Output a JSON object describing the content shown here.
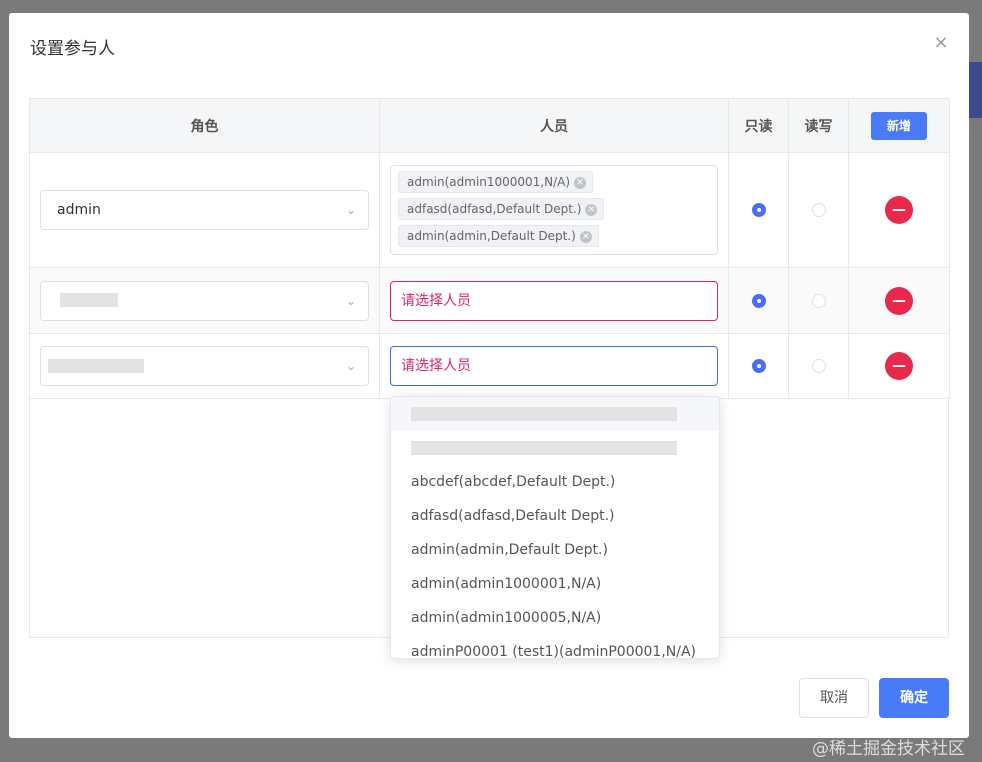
{
  "dialog": {
    "title": "设置参与人",
    "close_icon": "×"
  },
  "table": {
    "headers": {
      "role": "角色",
      "person": "人员",
      "readonly": "只读",
      "readwrite": "读写",
      "add": "新增"
    },
    "rows": [
      {
        "role": "admin",
        "persons": [
          "admin(admin1000001,N/A)",
          "adfasd(adfasd,Default Dept.)",
          "admin(admin,Default Dept.)"
        ],
        "permission": "readonly"
      },
      {
        "role": "",
        "placeholder": "请选择人员",
        "permission": "readonly"
      },
      {
        "role": "",
        "placeholder": "请选择人员",
        "permission": "readonly"
      }
    ],
    "delete_icon": "—"
  },
  "dropdown": {
    "options": [
      "abcdef(abcdef,Default Dept.)",
      "adfasd(adfasd,Default Dept.)",
      "admin(admin,Default Dept.)",
      "admin(admin1000001,N/A)",
      "admin(admin1000005,N/A)",
      "adminP00001 (test1)(adminP00001,N/A)"
    ]
  },
  "footer": {
    "cancel": "取消",
    "confirm": "确定"
  },
  "watermark": "@稀土掘金技术社区",
  "colors": {
    "primary": "#4a7bf7",
    "danger": "#e8294c",
    "error_text": "#e0245e"
  }
}
